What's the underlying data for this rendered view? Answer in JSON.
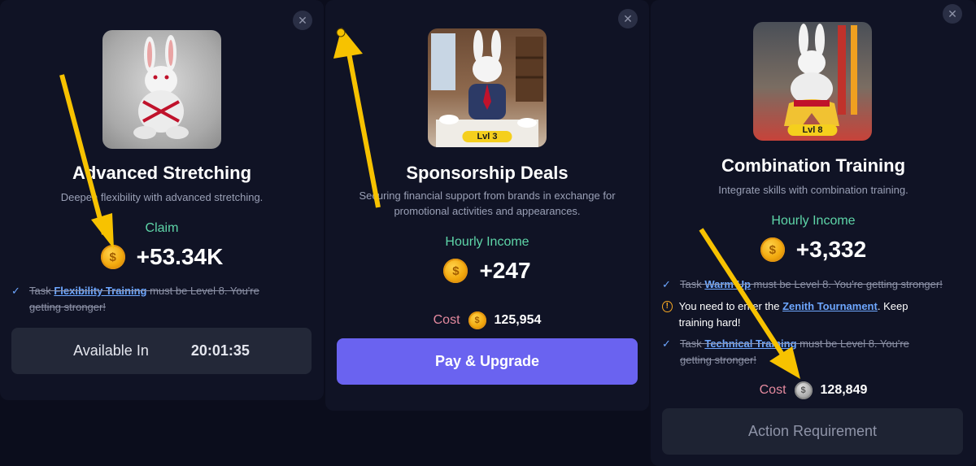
{
  "card1": {
    "title": "Advanced Stretching",
    "description": "Deepen flexibility with advanced stretching.",
    "claim_label": "Claim",
    "claim_value": "+53.34K",
    "req": {
      "prefix": "Task ",
      "link": "Flexibility Training",
      "suffix": " must be Level 8. You're getting stronger!"
    },
    "button": {
      "label": "Available In",
      "timer": "20:01:35"
    }
  },
  "card2": {
    "level": "Lvl 3",
    "title": "Sponsorship Deals",
    "description": "Securing financial support from brands in exchange for promotional activities and appearances.",
    "income_label": "Hourly Income",
    "income_value": "+247",
    "cost_label": "Cost",
    "cost_value": "125,954",
    "button_label": "Pay & Upgrade"
  },
  "card3": {
    "level": "Lvl 8",
    "title": "Combination Training",
    "description": "Integrate skills with combination training.",
    "income_label": "Hourly Income",
    "income_value": "+3,332",
    "req1": {
      "prefix": "Task ",
      "link": "Warm Up",
      "suffix": " must be Level 8. You're getting stronger!"
    },
    "req2": {
      "prefix": "You need to enter the ",
      "link": "Zenith Tournament",
      "suffix": ". Keep training hard!"
    },
    "req3": {
      "prefix": "Task ",
      "link": "Technical Training",
      "suffix": " must be Level 8. You're getting stronger!"
    },
    "cost_label": "Cost",
    "cost_value": "128,849",
    "button_label": "Action Requirement"
  },
  "icons": {
    "close": "close-icon",
    "coin": "coin-icon",
    "check": "check-icon",
    "warning": "warning-icon"
  },
  "colors": {
    "background": "#0b0d1c",
    "card": "#101325",
    "accent_green": "#5ed5a8",
    "cost_label": "#e58a9f",
    "link": "#6ea7ff",
    "primary_button": "#6a63f0",
    "annotation_arrow": "#f7c200"
  }
}
